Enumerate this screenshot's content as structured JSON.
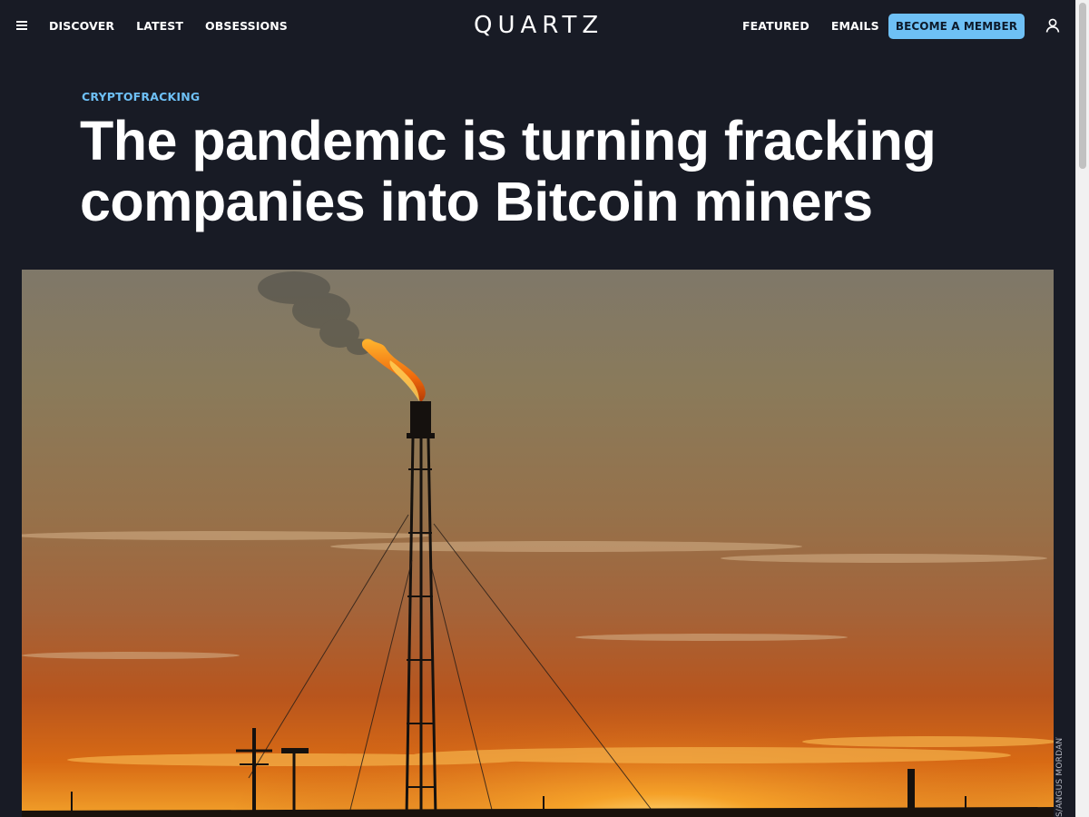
{
  "nav": {
    "menu_icon": "hamburger-icon",
    "left_links": [
      "DISCOVER",
      "LATEST",
      "OBSESSIONS"
    ],
    "logo": "QUARTZ",
    "right_links": [
      "FEATURED",
      "EMAILS"
    ],
    "member_button": "BECOME A MEMBER",
    "user_icon": "user-icon",
    "accent_color": "#6ec0f5",
    "background_color": "#181b25"
  },
  "article": {
    "kicker": "CRYPTOFRACKING",
    "headline": "The pandemic is turning fracking companies into Bitcoin miners"
  },
  "hero": {
    "alt": "A gas flare burns atop a tower at sunset in an oil field",
    "credit": "S/ANGUS MORDANT"
  }
}
